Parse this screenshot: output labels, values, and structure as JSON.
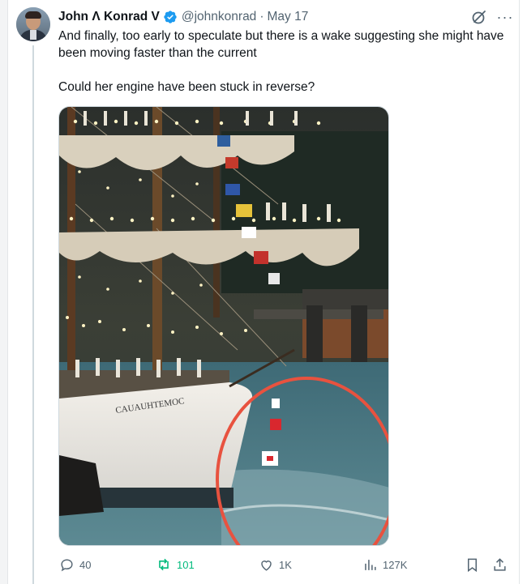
{
  "tweet": {
    "author_name": "John Λ Konrad V",
    "handle": "@johnkonrad",
    "separator": "·",
    "date": "May 17",
    "more_label": "···",
    "paragraphs": [
      "And finally, too early to speculate but there is a wake suggesting she might have been moving faster than the current",
      "Could her engine have been stuck in reverse?"
    ],
    "media": {
      "hull_name": "CAUAUHTEMOC",
      "highlight_color": "#e8523f"
    }
  },
  "actions": {
    "replies": "40",
    "reposts": "101",
    "likes": "1K",
    "views": "127K"
  },
  "colors": {
    "text": "#0f1419",
    "muted": "#536471",
    "verified": "#1d9bf0",
    "repost": "#00ba7c"
  },
  "icons": [
    "verified-badge-icon",
    "grok-icon",
    "more-icon",
    "reply-icon",
    "repost-icon",
    "like-icon",
    "views-icon",
    "bookmark-icon",
    "share-icon"
  ]
}
